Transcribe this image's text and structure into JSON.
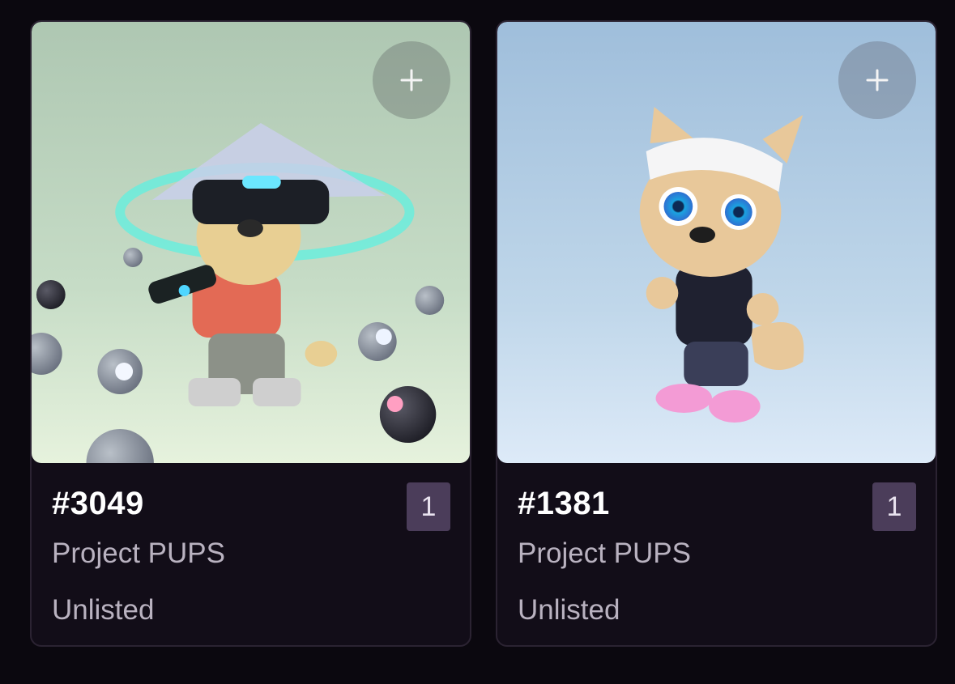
{
  "cards": [
    {
      "token_id": "#3049",
      "collection": "Project PUPS",
      "status": "Unlisted",
      "quantity": "1",
      "image_name": "pup-3049-image",
      "background_color": "#b7cfbb"
    },
    {
      "token_id": "#1381",
      "collection": "Project PUPS",
      "status": "Unlisted",
      "quantity": "1",
      "image_name": "pup-1381-image",
      "background_color": "#a9c4de"
    }
  ],
  "icons": {
    "add": "plus-icon"
  },
  "colors": {
    "page_background": "#0b080f",
    "card_background": "#120d18",
    "badge_background": "#4b3d5a"
  }
}
